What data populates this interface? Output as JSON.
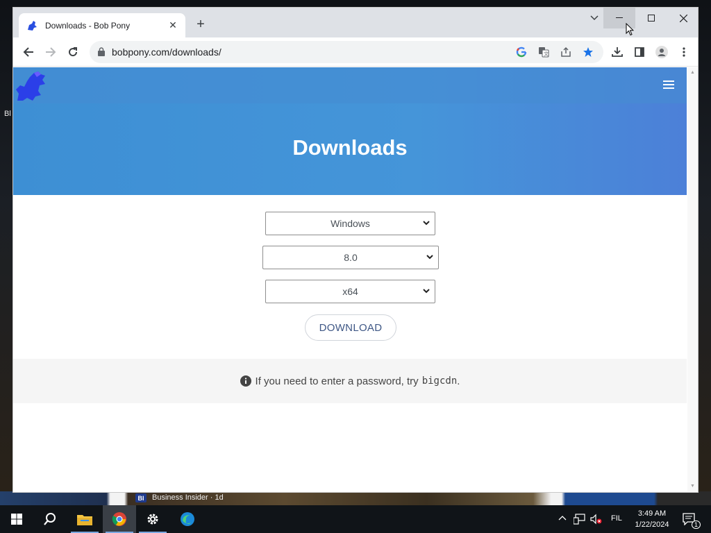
{
  "desktop": {
    "icon_text": "Bl",
    "news_badge": "BI",
    "news_text": "Business Insider · 1d"
  },
  "browser": {
    "tab": {
      "title": "Downloads - Bob Pony",
      "close": "✕"
    },
    "new_tab": "+",
    "window_controls": {
      "minimize": "—",
      "maximize": "☐",
      "close": "✕"
    },
    "url": "bobpony.com/downloads/",
    "omnibox_icons": [
      "google-icon",
      "translate-icon",
      "share-icon",
      "bookmark-star-icon"
    ],
    "toolbar_icons": [
      "downloads-icon",
      "side-panel-icon",
      "profile-icon",
      "menu-dots-icon"
    ]
  },
  "page": {
    "title": "Downloads",
    "selects": {
      "os": "Windows",
      "version": "8.0",
      "arch": "x64"
    },
    "download_button": "DOWNLOAD",
    "info_text": "If you need to enter a password, try",
    "info_code": "bigcdn",
    "info_end": "."
  },
  "taskbar": {
    "items": [
      "start-icon",
      "search-icon",
      "file-explorer-icon",
      "chrome-icon",
      "settings-icon",
      "edge-icon"
    ],
    "language": "FIL",
    "time": "3:49 AM",
    "date": "1/22/2024",
    "notification_count": "1"
  },
  "colors": {
    "header_blue": "#4595d9",
    "button_text": "#3e5785",
    "star_blue": "#1a73e8"
  }
}
